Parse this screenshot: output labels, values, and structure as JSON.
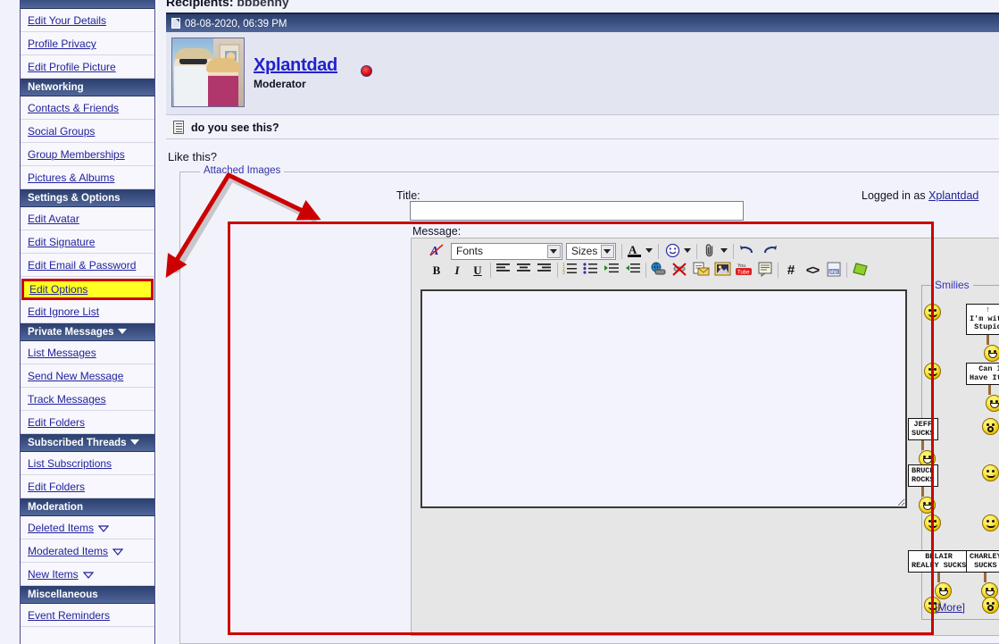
{
  "sidebar": {
    "sections": [
      {
        "type": "header",
        "label": "",
        "partial": true
      },
      {
        "type": "item",
        "label": "Edit Your Details"
      },
      {
        "type": "item",
        "label": "Profile Privacy"
      },
      {
        "type": "item",
        "label": "Edit Profile Picture"
      },
      {
        "type": "header",
        "label": "Networking"
      },
      {
        "type": "item",
        "label": "Contacts & Friends"
      },
      {
        "type": "item",
        "label": "Social Groups"
      },
      {
        "type": "item",
        "label": "Group Memberships"
      },
      {
        "type": "item",
        "label": "Pictures & Albums"
      },
      {
        "type": "header",
        "label": "Settings & Options"
      },
      {
        "type": "item",
        "label": "Edit Avatar"
      },
      {
        "type": "item",
        "label": "Edit Signature"
      },
      {
        "type": "item",
        "label": "Edit Email & Password"
      },
      {
        "type": "item",
        "label": "Edit Options",
        "highlighted": true
      },
      {
        "type": "item",
        "label": "Edit Ignore List"
      },
      {
        "type": "header",
        "label": "Private Messages",
        "caret": true
      },
      {
        "type": "item",
        "label": "List Messages"
      },
      {
        "type": "item",
        "label": "Send New Message"
      },
      {
        "type": "item",
        "label": "Track Messages"
      },
      {
        "type": "item",
        "label": "Edit Folders"
      },
      {
        "type": "header",
        "label": "Subscribed Threads",
        "caret": true
      },
      {
        "type": "item",
        "label": "List Subscriptions"
      },
      {
        "type": "item",
        "label": "Edit Folders"
      },
      {
        "type": "header",
        "label": "Moderation"
      },
      {
        "type": "item",
        "label": "Deleted Items",
        "outline_caret": true
      },
      {
        "type": "item",
        "label": "Moderated Items",
        "outline_caret": true
      },
      {
        "type": "item",
        "label": "New Items",
        "outline_caret": true
      },
      {
        "type": "header",
        "label": "Miscellaneous"
      },
      {
        "type": "item",
        "label": "Event Reminders"
      }
    ]
  },
  "message_view": {
    "recipients_label": "Recipients",
    "recipients_value": "bbbenny",
    "date": "08-08-2020, 06:39 PM",
    "username": "Xplantdad",
    "usertitle": "Moderator",
    "subject": "do you see this?",
    "body_text": "Like this?"
  },
  "attachments": {
    "legend": "Attached Images"
  },
  "form": {
    "title_label": "Title:",
    "title_value": "",
    "logged_in_prefix": "Logged in as",
    "logged_in_user": "Xplantdad",
    "message_label": "Message:",
    "message_value": ""
  },
  "editor": {
    "font_select": "Fonts",
    "size_select": "Sizes",
    "toolbar_row1": [
      {
        "name": "remove-formatting-icon",
        "glyph": "A"
      },
      {
        "name": "font-color-icon",
        "glyph": "A"
      },
      {
        "name": "smilie-icon",
        "glyph": "☺"
      },
      {
        "name": "attachment-icon",
        "glyph": "📎"
      },
      {
        "name": "undo-icon",
        "glyph": "↶"
      },
      {
        "name": "redo-icon",
        "glyph": "↷"
      }
    ],
    "toolbar_row2": [
      {
        "name": "bold-icon",
        "glyph": "B"
      },
      {
        "name": "italic-icon",
        "glyph": "I"
      },
      {
        "name": "underline-icon",
        "glyph": "U"
      },
      {
        "name": "align-left-icon",
        "glyph": ""
      },
      {
        "name": "align-center-icon",
        "glyph": ""
      },
      {
        "name": "align-right-icon",
        "glyph": ""
      },
      {
        "name": "ordered-list-icon",
        "glyph": ""
      },
      {
        "name": "unordered-list-icon",
        "glyph": ""
      },
      {
        "name": "outdent-icon",
        "glyph": ""
      },
      {
        "name": "indent-icon",
        "glyph": ""
      },
      {
        "name": "insert-link-icon",
        "glyph": ""
      },
      {
        "name": "remove-link-icon",
        "glyph": ""
      },
      {
        "name": "insert-email-icon",
        "glyph": ""
      },
      {
        "name": "insert-image-icon",
        "glyph": ""
      },
      {
        "name": "insert-video-icon",
        "glyph": ""
      },
      {
        "name": "quote-icon",
        "glyph": ""
      },
      {
        "name": "hash-icon",
        "glyph": "#"
      },
      {
        "name": "code-icon",
        "glyph": "<>"
      },
      {
        "name": "php-icon",
        "glyph": "php"
      },
      {
        "name": "highlight-icon",
        "glyph": ""
      }
    ],
    "toggle_mode_label": "A",
    "smilies_legend": "Smilies",
    "smilies_more": "[More]",
    "smilies": [
      {
        "row": 0,
        "col": 0,
        "name": "smilie-confused",
        "type": "face"
      },
      {
        "row": 0,
        "col": 1,
        "name": "smilie-im-with-stupid",
        "type": "sign",
        "sign_text": "↑\nI'm with\nStupid"
      },
      {
        "row": 0,
        "col": 2,
        "name": "smilie-cool",
        "type": "face"
      },
      {
        "row": 1,
        "col": 0,
        "name": "smilie-bow",
        "type": "face"
      },
      {
        "row": 1,
        "col": 1,
        "name": "smilie-can-i-have-it",
        "type": "sign",
        "sign_text": "Can I\nHave It??"
      },
      {
        "row": 1,
        "col": 2,
        "name": "smilie-grin",
        "type": "face"
      },
      {
        "row": 2,
        "col": 0,
        "name": "smilie-jeff-sucks",
        "type": "sign",
        "sign_text": "JEFF\nSUCKS"
      },
      {
        "row": 2,
        "col": 1,
        "name": "smilie-surprised",
        "type": "face"
      },
      {
        "row": 2,
        "col": 2,
        "name": "smilie-bonk",
        "type": "face"
      },
      {
        "row": 3,
        "col": 0,
        "name": "smilie-bruce-rocks",
        "type": "sign",
        "sign_text": "BRUCE\nROCKS"
      },
      {
        "row": 3,
        "col": 1,
        "name": "smilie-hug",
        "type": "face"
      },
      {
        "row": 3,
        "col": 2,
        "name": "smilie-wave",
        "type": "face"
      },
      {
        "row": 4,
        "col": 0,
        "name": "smilie-smile-small",
        "type": "face"
      },
      {
        "row": 4,
        "col": 1,
        "name": "smilie-drink",
        "type": "face"
      },
      {
        "row": 4,
        "col": 2,
        "name": "smilie-frown",
        "type": "face"
      },
      {
        "row": 5,
        "col": 0,
        "name": "smilie-belair-really-sucks",
        "type": "sign",
        "sign_text": "BELAIR\nREALLY SUCKS"
      },
      {
        "row": 5,
        "col": 1,
        "name": "smilie-charley-sucks",
        "type": "sign",
        "sign_text": "CHARLEY\nSUCKS"
      },
      {
        "row": 5,
        "col": 2,
        "name": "smilie-laugh",
        "type": "face"
      },
      {
        "row": 6,
        "col": 0,
        "name": "smilie-wink",
        "type": "face"
      },
      {
        "row": 6,
        "col": 1,
        "name": "smilie-question",
        "type": "face"
      }
    ]
  },
  "annotations": {
    "highlight_target": "Edit Options",
    "highlight_color": "#ffff22",
    "arrow_color": "#cc0000",
    "rect_color": "#cc0000"
  }
}
